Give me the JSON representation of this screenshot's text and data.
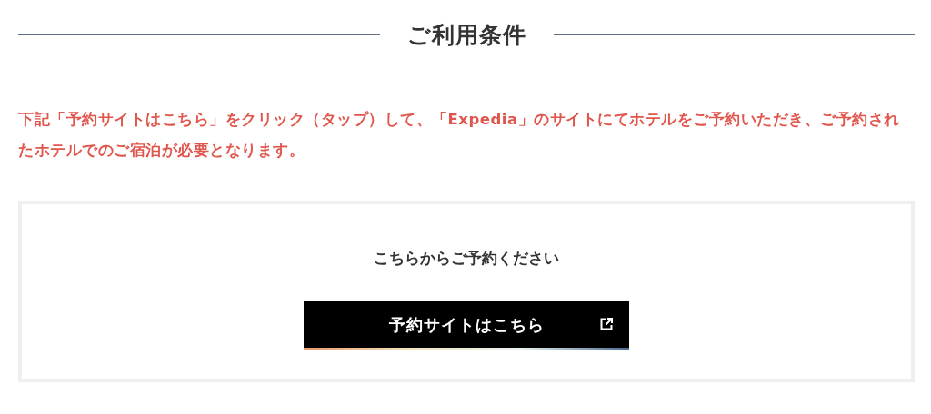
{
  "section": {
    "title": "ご利用条件"
  },
  "notice": "下記「予約サイトはこちら」をクリック（タップ）して、「Expedia」のサイトにてホテルをご予約いただき、ご予約されたホテルでのご宿泊が必要となります。",
  "booking_card": {
    "prompt": "こちらからご予約ください",
    "button": "予約サイトはこちら"
  }
}
